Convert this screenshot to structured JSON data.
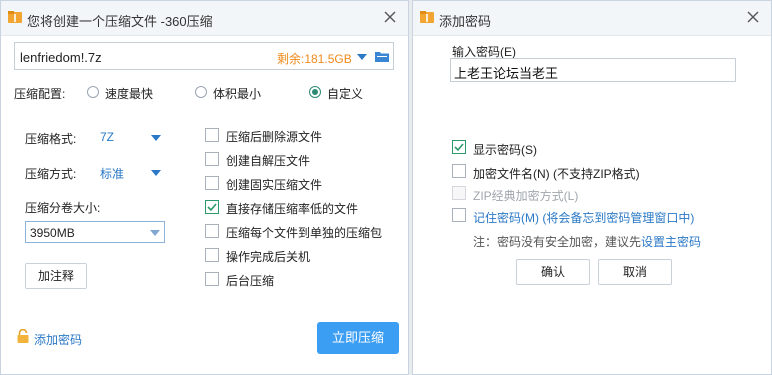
{
  "left_window": {
    "title": "您将创建一个压缩文件 -360压缩",
    "file_name": "lenfriedom!.7z",
    "free_space": "剩余:181.5GB",
    "config_label": "压缩配置:",
    "config_options": [
      "速度最快",
      "体积最小",
      "自定义"
    ],
    "config_selected": "自定义",
    "format_label": "压缩格式:",
    "format_value": "7Z",
    "method_label": "压缩方式:",
    "method_value": "标准",
    "volume_label": "压缩分卷大小:",
    "volume_value": "3950MB",
    "comment_button": "加注释",
    "options": [
      {
        "label": "压缩后删除源文件",
        "checked": false
      },
      {
        "label": "创建自解压文件",
        "checked": false
      },
      {
        "label": "创建固实压缩文件",
        "checked": false
      },
      {
        "label": "直接存储压缩率低的文件",
        "checked": true
      },
      {
        "label": "压缩每个文件到单独的压缩包",
        "checked": false
      },
      {
        "label": "操作完成后关机",
        "checked": false
      },
      {
        "label": "后台压缩",
        "checked": false
      }
    ],
    "add_password_link": "添加密码",
    "start_button": "立即压缩"
  },
  "right_window": {
    "title": "添加密码",
    "input_label": "输入密码(E)",
    "password_value": "上老王论坛当老王",
    "options": [
      {
        "label": "显示密码(S)",
        "checked": true,
        "disabled": false
      },
      {
        "label": "加密文件名(N) (不支持ZIP格式)",
        "checked": false,
        "disabled": false
      },
      {
        "label": "ZIP经典加密方式(L)",
        "checked": false,
        "disabled": true
      }
    ],
    "remember_label": "记住密码(M) (将会备忘到密码管理窗口中)",
    "note_prefix": "注：密码没有安全加密，建议先",
    "note_link": "设置主密码",
    "ok_button": "确认",
    "cancel_button": "取消"
  },
  "colors": {
    "accent_blue": "#2a78c6",
    "primary_button": "#3c9ef2",
    "free_space_orange": "#ee8a1a",
    "check_green": "#2c9a68"
  }
}
